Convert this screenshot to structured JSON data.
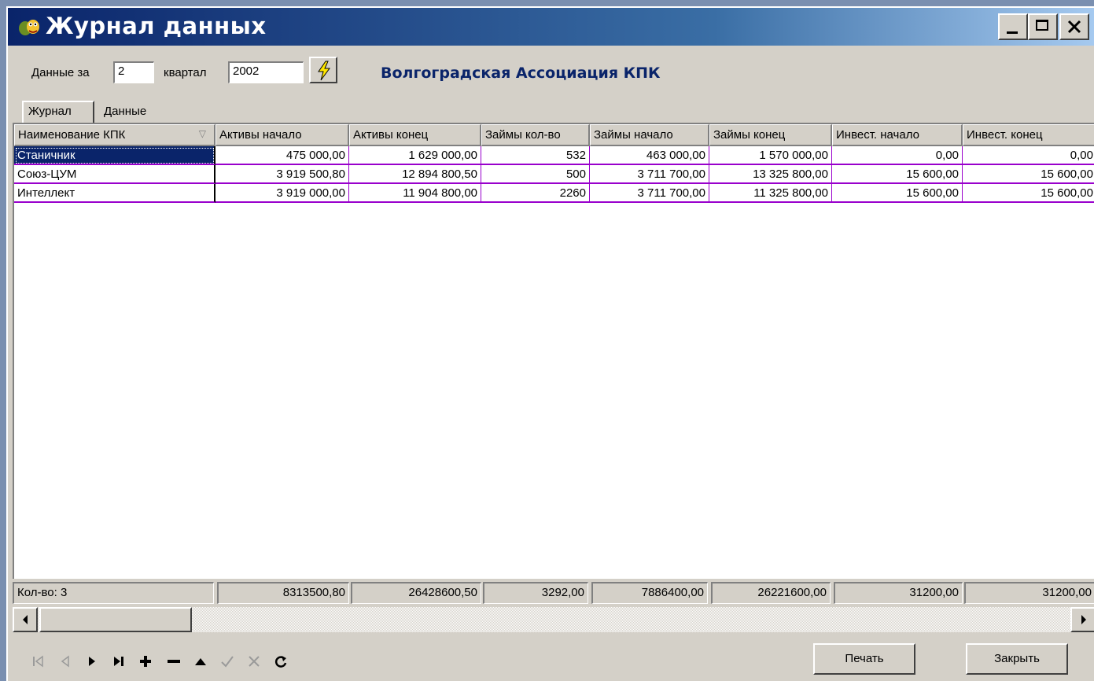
{
  "window": {
    "title": "Журнал данных",
    "icon": "app-icon"
  },
  "filter": {
    "data_for_label": "Данные за",
    "quarter_value": "2",
    "quarter_label": "квартал",
    "year_value": "2002",
    "refresh_icon": "lightning-icon"
  },
  "organization": "Волгоградская Ассоциация КПК",
  "tabs": [
    {
      "label": "Журнал"
    },
    {
      "label": "Данные"
    }
  ],
  "grid": {
    "columns": [
      "Наименование КПК",
      "Активы начало",
      "Активы конец",
      "Займы кол-во",
      "Займы начало",
      "Займы конец",
      "Инвест. начало",
      "Инвест. конец"
    ],
    "rows": [
      [
        "Станичник",
        "475 000,00",
        "1 629 000,00",
        "532",
        "463 000,00",
        "1 570 000,00",
        "0,00",
        "0,00"
      ],
      [
        "Союз-ЦУМ",
        "3 919 500,80",
        "12 894 800,50",
        "500",
        "3 711 700,00",
        "13 325 800,00",
        "15 600,00",
        "15 600,00"
      ],
      [
        "Интеллект",
        "3 919 000,00",
        "11 904 800,00",
        "2260",
        "3 711 700,00",
        "11 325 800,00",
        "15 600,00",
        "15 600,00"
      ]
    ],
    "footer": [
      "Кол-во: 3",
      "8313500,80",
      "26428600,50",
      "3292,00",
      "7886400,00",
      "26221600,00",
      "31200,00",
      "31200,00"
    ]
  },
  "navigator": [
    "first-icon",
    "prior-icon",
    "next-icon",
    "last-icon",
    "insert-icon",
    "delete-icon",
    "edit-icon",
    "post-icon",
    "cancel-icon",
    "refresh-icon"
  ],
  "buttons": {
    "print": "Печать",
    "close": "Закрыть"
  },
  "colors": {
    "title_bar": "#0a246a",
    "grid_lines": "#9900cc",
    "selection": "#0a246a",
    "organization_text": "#0a246a"
  }
}
